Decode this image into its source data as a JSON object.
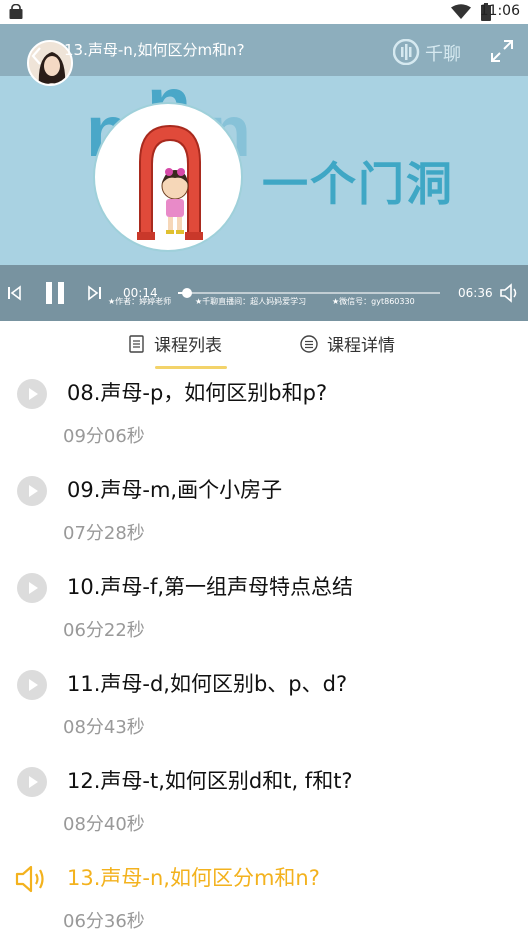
{
  "status_bar": {
    "time": "11:06"
  },
  "player": {
    "title": "13.声母-n,如何区分m和n?",
    "letters": [
      "n",
      "n",
      "n"
    ],
    "caption": "一个门洞",
    "brand": "千聊",
    "current_time": "00:14",
    "total_time": "06:36",
    "progress_fraction": 0.035,
    "watermarks": [
      "★作者：婷婷老师",
      "★千聊直播间：超人妈妈爱学习",
      "★微信号：gyt860330"
    ],
    "colors": {
      "caption": "#3fa7c5",
      "background": "#a9d2e2"
    }
  },
  "tabs": [
    {
      "label": "课程列表",
      "icon": "document-icon",
      "active": true
    },
    {
      "label": "课程详情",
      "icon": "list-icon",
      "active": false
    }
  ],
  "lessons": [
    {
      "title": "08.声母-p，如何区别b和p?",
      "duration": "09分06秒",
      "active": false
    },
    {
      "title": "09.声母-m,画个小房子",
      "duration": "07分28秒",
      "active": false
    },
    {
      "title": "10.声母-f,第一组声母特点总结",
      "duration": "06分22秒",
      "active": false
    },
    {
      "title": "11.声母-d,如何区别b、p、d?",
      "duration": "08分43秒",
      "active": false
    },
    {
      "title": "12.声母-t,如何区别d和t, f和t?",
      "duration": "08分40秒",
      "active": false
    },
    {
      "title": "13.声母-n,如何区分m和n?",
      "duration": "06分36秒",
      "active": true
    }
  ],
  "accent_color": "#f3b21e"
}
